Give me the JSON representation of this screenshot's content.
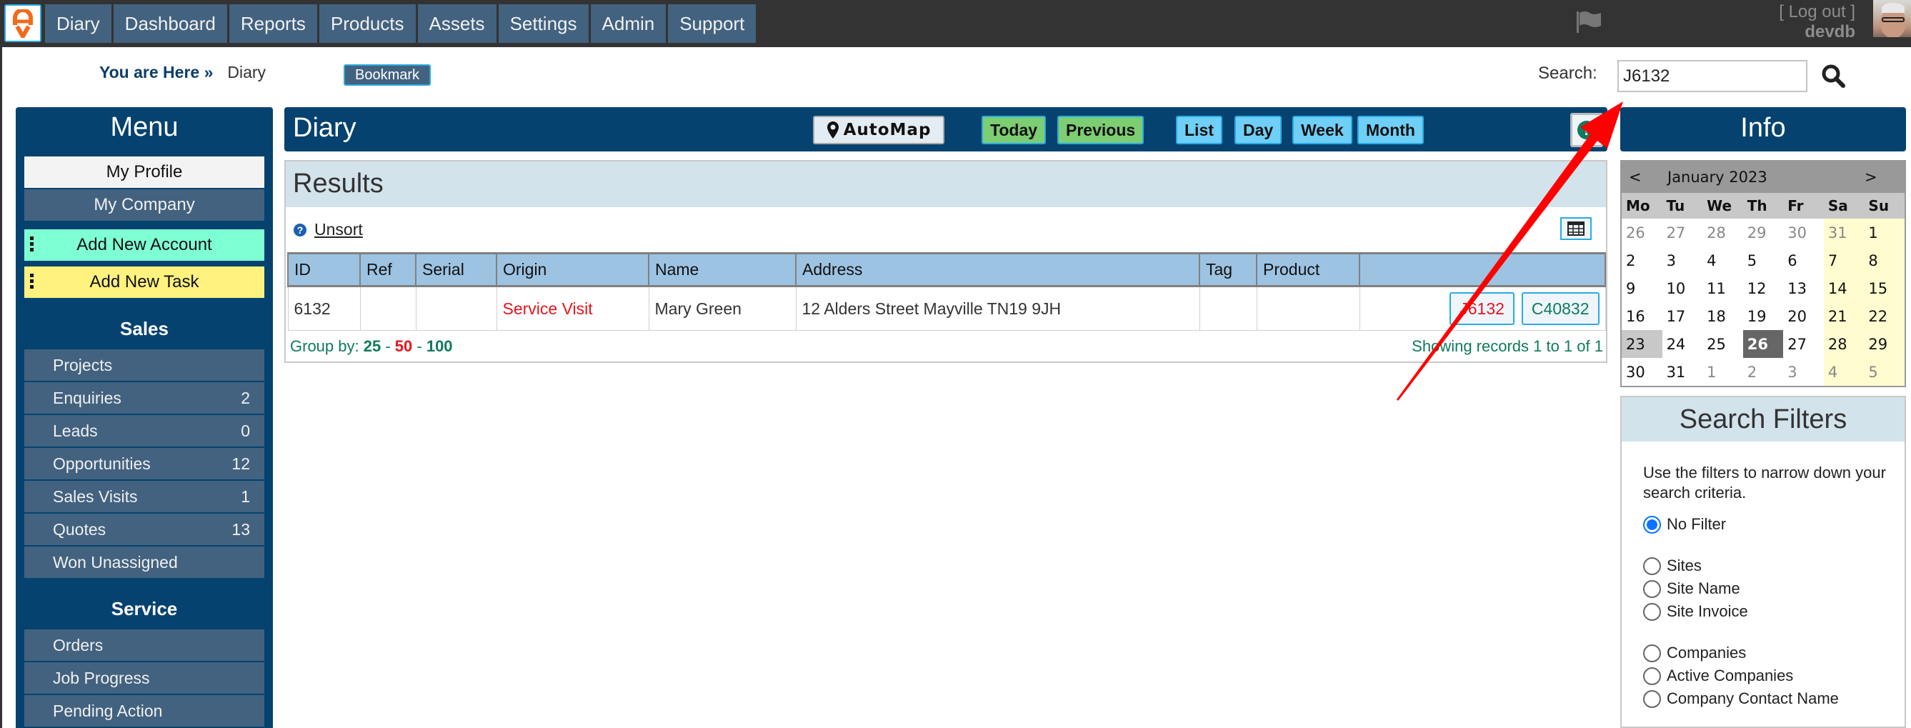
{
  "topbar": {
    "logo_alt": "AV logo",
    "nav": [
      {
        "label": "Diary"
      },
      {
        "label": "Dashboard"
      },
      {
        "label": "Reports"
      },
      {
        "label": "Products"
      },
      {
        "label": "Assets"
      },
      {
        "label": "Settings"
      },
      {
        "label": "Admin"
      },
      {
        "label": "Support"
      }
    ],
    "logout_label": "[ Log out ]",
    "username": "devdb"
  },
  "breadcrumb": {
    "label": "You are Here »",
    "current": "Diary",
    "bookmark_label": "Bookmark"
  },
  "search": {
    "label": "Search:",
    "value": "J6132",
    "placeholder": ""
  },
  "sidebar": {
    "title": "Menu",
    "my_profile": "My Profile",
    "my_company": "My Company",
    "add_account": "Add New Account",
    "add_task": "Add New Task",
    "sections": [
      {
        "title": "Sales",
        "items": [
          {
            "label": "Projects",
            "count": ""
          },
          {
            "label": "Enquiries",
            "count": "2"
          },
          {
            "label": "Leads",
            "count": "0"
          },
          {
            "label": "Opportunities",
            "count": "12"
          },
          {
            "label": "Sales Visits",
            "count": "1"
          },
          {
            "label": "Quotes",
            "count": "13"
          },
          {
            "label": "Won Unassigned",
            "count": ""
          }
        ]
      },
      {
        "title": "Service",
        "items": [
          {
            "label": "Orders",
            "count": ""
          },
          {
            "label": "Job Progress",
            "count": ""
          },
          {
            "label": "Pending Action",
            "count": ""
          }
        ]
      }
    ]
  },
  "main": {
    "title": "Diary",
    "automap_label": "AutoMap",
    "buttons": {
      "today": "Today",
      "previous": "Previous",
      "list": "List",
      "day": "Day",
      "week": "Week",
      "month": "Month"
    },
    "results_title": "Results",
    "unsort_label": "Unsort",
    "table": {
      "headers": [
        "ID",
        "Ref",
        "Serial",
        "Origin",
        "Name",
        "Address",
        "Tag",
        "Product",
        ""
      ],
      "rows": [
        {
          "id": "6132",
          "ref": "",
          "serial": "",
          "origin": "Service Visit",
          "name": "Mary Green",
          "address": "12 Alders Street Mayville TN19 9JH",
          "tag": "",
          "product": "",
          "job_link": "J6132",
          "company_link": "C40832"
        }
      ]
    },
    "group_by_label": "Group by:",
    "group_by_options": [
      "25",
      "50",
      "100"
    ],
    "group_by_active": "50",
    "records_text": "Showing records 1 to 1 of 1"
  },
  "info": {
    "title": "Info",
    "calendar": {
      "month_label": "January 2023",
      "prev": "<",
      "next": ">",
      "dow": [
        "Mo",
        "Tu",
        "We",
        "Th",
        "Fr",
        "Sa",
        "Su"
      ],
      "weeks": [
        [
          "26",
          "27",
          "28",
          "29",
          "30",
          "31",
          "1"
        ],
        [
          "2",
          "3",
          "4",
          "5",
          "6",
          "7",
          "8"
        ],
        [
          "9",
          "10",
          "11",
          "12",
          "13",
          "14",
          "15"
        ],
        [
          "16",
          "17",
          "18",
          "19",
          "20",
          "21",
          "22"
        ],
        [
          "23",
          "24",
          "25",
          "26",
          "27",
          "28",
          "29"
        ],
        [
          "30",
          "31",
          "1",
          "2",
          "3",
          "4",
          "5"
        ]
      ],
      "today": "26",
      "selected": "23"
    },
    "filters": {
      "title": "Search Filters",
      "description": "Use the filters to narrow down your search criteria.",
      "groups": [
        [
          "No Filter"
        ],
        [
          "Sites",
          "Site Name",
          "Site Invoice"
        ],
        [
          "Companies",
          "Active Companies",
          "Company Contact Name"
        ]
      ],
      "selected": "No Filter"
    }
  },
  "colors": {
    "brand_dark": "#05426f",
    "nav_item": "#42627f",
    "accent_cyan": "#29abe2",
    "green_btn": "#7dcd73",
    "blue_btn": "#6fcff6",
    "add_account": "#7fffd4",
    "add_task": "#fff27f",
    "link_red": "#e8141c",
    "link_green": "#0f7a5e",
    "annotation_arrow": "#ff0000"
  }
}
